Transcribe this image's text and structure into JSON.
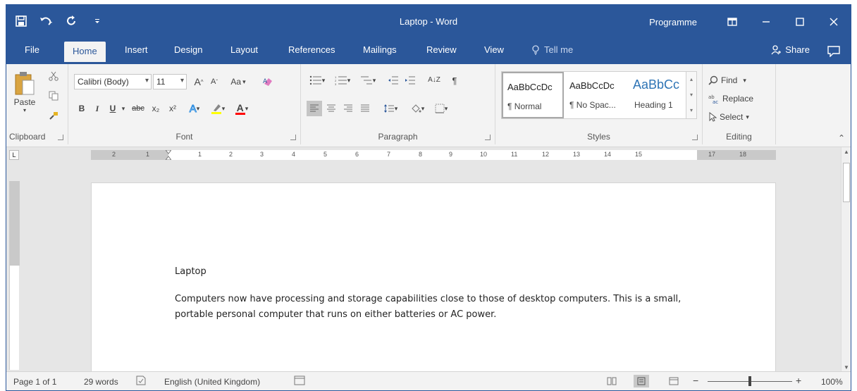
{
  "window": {
    "title": "Laptop  -  Word",
    "account": "Programme"
  },
  "qat": {
    "icons": [
      "save-icon",
      "undo-icon",
      "redo-icon",
      "customize-qat-icon"
    ]
  },
  "tabs": [
    {
      "label": "File"
    },
    {
      "label": "Home"
    },
    {
      "label": "Insert"
    },
    {
      "label": "Design"
    },
    {
      "label": "Layout"
    },
    {
      "label": "References"
    },
    {
      "label": "Mailings"
    },
    {
      "label": "Review"
    },
    {
      "label": "View"
    }
  ],
  "tell_me": "Tell me",
  "share": "Share",
  "ribbon": {
    "clipboard": {
      "paste": "Paste",
      "label": "Clipboard"
    },
    "font": {
      "name": "Calibri (Body)",
      "size": "11",
      "grow": "A",
      "shrink": "A",
      "case": "Aa",
      "bold": "B",
      "italic": "I",
      "underline": "U",
      "strike": "abc",
      "subscript": "x₂",
      "superscript": "x²",
      "text_effects": "A",
      "font_color": "A",
      "label": "Font"
    },
    "paragraph": {
      "label": "Paragraph",
      "sort": "A↓Z",
      "pilcrow": "¶"
    },
    "styles": {
      "items": [
        {
          "preview": "AaBbCcDc",
          "name": "¶ Normal"
        },
        {
          "preview": "AaBbCcDc",
          "name": "¶ No Spac..."
        },
        {
          "preview": "AaBbCc",
          "name": "Heading 1"
        }
      ],
      "label": "Styles"
    },
    "editing": {
      "find": "Find",
      "replace": "Replace",
      "select": "Select",
      "label": "Editing"
    }
  },
  "document": {
    "title": "Laptop",
    "body": "Computers now have processing and storage capabilities close to those of desktop computers. This is a small, portable personal computer that runs on either batteries or AC power."
  },
  "ruler": {
    "labels": [
      "2",
      "1",
      "1",
      "2",
      "3",
      "4",
      "5",
      "6",
      "7",
      "8",
      "9",
      "10",
      "11",
      "12",
      "13",
      "14",
      "15",
      "17",
      "18"
    ]
  },
  "status": {
    "page": "Page 1 of 1",
    "words": "29 words",
    "language": "English (United Kingdom)",
    "zoom": "100%"
  },
  "colors": {
    "accent": "#2b579a",
    "heading": "#2e74b5",
    "highlight": "#ffff00",
    "font_color": "#ff0000"
  }
}
